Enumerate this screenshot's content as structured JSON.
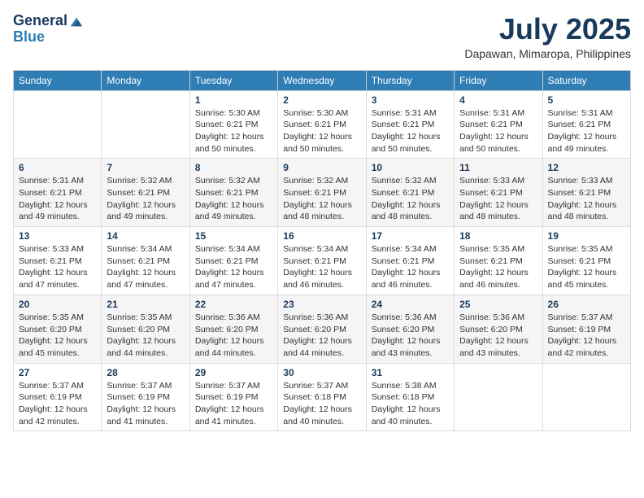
{
  "header": {
    "logo_general": "General",
    "logo_blue": "Blue",
    "title": "July 2025",
    "location": "Dapawan, Mimaropa, Philippines"
  },
  "weekdays": [
    "Sunday",
    "Monday",
    "Tuesday",
    "Wednesday",
    "Thursday",
    "Friday",
    "Saturday"
  ],
  "weeks": [
    [
      {
        "day": "",
        "info": ""
      },
      {
        "day": "",
        "info": ""
      },
      {
        "day": "1",
        "info": "Sunrise: 5:30 AM\nSunset: 6:21 PM\nDaylight: 12 hours and 50 minutes."
      },
      {
        "day": "2",
        "info": "Sunrise: 5:30 AM\nSunset: 6:21 PM\nDaylight: 12 hours and 50 minutes."
      },
      {
        "day": "3",
        "info": "Sunrise: 5:31 AM\nSunset: 6:21 PM\nDaylight: 12 hours and 50 minutes."
      },
      {
        "day": "4",
        "info": "Sunrise: 5:31 AM\nSunset: 6:21 PM\nDaylight: 12 hours and 50 minutes."
      },
      {
        "day": "5",
        "info": "Sunrise: 5:31 AM\nSunset: 6:21 PM\nDaylight: 12 hours and 49 minutes."
      }
    ],
    [
      {
        "day": "6",
        "info": "Sunrise: 5:31 AM\nSunset: 6:21 PM\nDaylight: 12 hours and 49 minutes."
      },
      {
        "day": "7",
        "info": "Sunrise: 5:32 AM\nSunset: 6:21 PM\nDaylight: 12 hours and 49 minutes."
      },
      {
        "day": "8",
        "info": "Sunrise: 5:32 AM\nSunset: 6:21 PM\nDaylight: 12 hours and 49 minutes."
      },
      {
        "day": "9",
        "info": "Sunrise: 5:32 AM\nSunset: 6:21 PM\nDaylight: 12 hours and 48 minutes."
      },
      {
        "day": "10",
        "info": "Sunrise: 5:32 AM\nSunset: 6:21 PM\nDaylight: 12 hours and 48 minutes."
      },
      {
        "day": "11",
        "info": "Sunrise: 5:33 AM\nSunset: 6:21 PM\nDaylight: 12 hours and 48 minutes."
      },
      {
        "day": "12",
        "info": "Sunrise: 5:33 AM\nSunset: 6:21 PM\nDaylight: 12 hours and 48 minutes."
      }
    ],
    [
      {
        "day": "13",
        "info": "Sunrise: 5:33 AM\nSunset: 6:21 PM\nDaylight: 12 hours and 47 minutes."
      },
      {
        "day": "14",
        "info": "Sunrise: 5:34 AM\nSunset: 6:21 PM\nDaylight: 12 hours and 47 minutes."
      },
      {
        "day": "15",
        "info": "Sunrise: 5:34 AM\nSunset: 6:21 PM\nDaylight: 12 hours and 47 minutes."
      },
      {
        "day": "16",
        "info": "Sunrise: 5:34 AM\nSunset: 6:21 PM\nDaylight: 12 hours and 46 minutes."
      },
      {
        "day": "17",
        "info": "Sunrise: 5:34 AM\nSunset: 6:21 PM\nDaylight: 12 hours and 46 minutes."
      },
      {
        "day": "18",
        "info": "Sunrise: 5:35 AM\nSunset: 6:21 PM\nDaylight: 12 hours and 46 minutes."
      },
      {
        "day": "19",
        "info": "Sunrise: 5:35 AM\nSunset: 6:21 PM\nDaylight: 12 hours and 45 minutes."
      }
    ],
    [
      {
        "day": "20",
        "info": "Sunrise: 5:35 AM\nSunset: 6:20 PM\nDaylight: 12 hours and 45 minutes."
      },
      {
        "day": "21",
        "info": "Sunrise: 5:35 AM\nSunset: 6:20 PM\nDaylight: 12 hours and 44 minutes."
      },
      {
        "day": "22",
        "info": "Sunrise: 5:36 AM\nSunset: 6:20 PM\nDaylight: 12 hours and 44 minutes."
      },
      {
        "day": "23",
        "info": "Sunrise: 5:36 AM\nSunset: 6:20 PM\nDaylight: 12 hours and 44 minutes."
      },
      {
        "day": "24",
        "info": "Sunrise: 5:36 AM\nSunset: 6:20 PM\nDaylight: 12 hours and 43 minutes."
      },
      {
        "day": "25",
        "info": "Sunrise: 5:36 AM\nSunset: 6:20 PM\nDaylight: 12 hours and 43 minutes."
      },
      {
        "day": "26",
        "info": "Sunrise: 5:37 AM\nSunset: 6:19 PM\nDaylight: 12 hours and 42 minutes."
      }
    ],
    [
      {
        "day": "27",
        "info": "Sunrise: 5:37 AM\nSunset: 6:19 PM\nDaylight: 12 hours and 42 minutes."
      },
      {
        "day": "28",
        "info": "Sunrise: 5:37 AM\nSunset: 6:19 PM\nDaylight: 12 hours and 41 minutes."
      },
      {
        "day": "29",
        "info": "Sunrise: 5:37 AM\nSunset: 6:19 PM\nDaylight: 12 hours and 41 minutes."
      },
      {
        "day": "30",
        "info": "Sunrise: 5:37 AM\nSunset: 6:18 PM\nDaylight: 12 hours and 40 minutes."
      },
      {
        "day": "31",
        "info": "Sunrise: 5:38 AM\nSunset: 6:18 PM\nDaylight: 12 hours and 40 minutes."
      },
      {
        "day": "",
        "info": ""
      },
      {
        "day": "",
        "info": ""
      }
    ]
  ]
}
